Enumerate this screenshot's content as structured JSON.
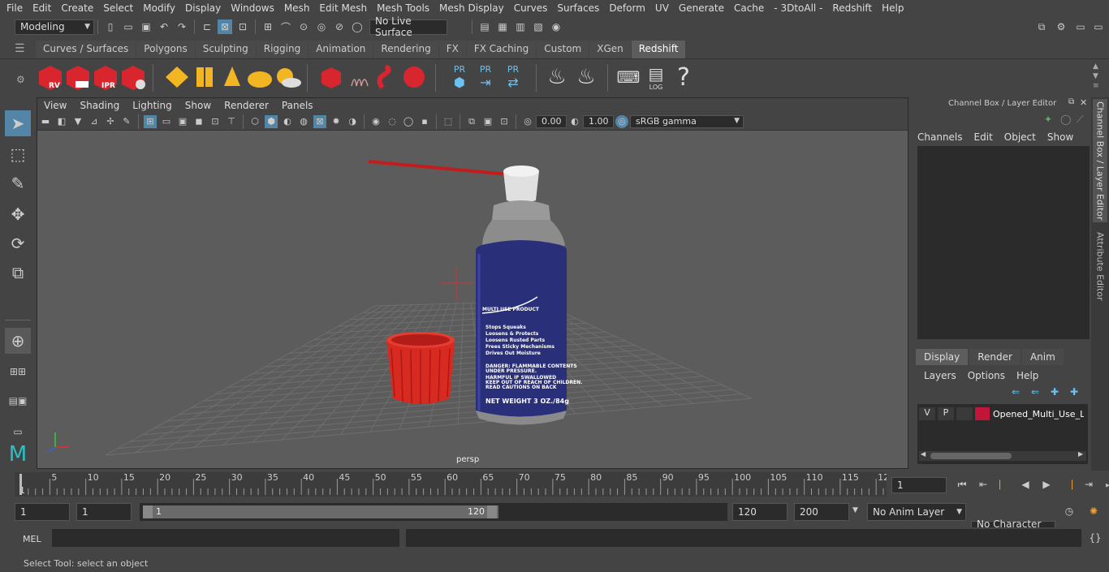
{
  "menu": [
    "File",
    "Edit",
    "Create",
    "Select",
    "Modify",
    "Display",
    "Windows",
    "Mesh",
    "Edit Mesh",
    "Mesh Tools",
    "Mesh Display",
    "Curves",
    "Surfaces",
    "Deform",
    "UV",
    "Generate",
    "Cache",
    "- 3DtoAll -",
    "Redshift",
    "Help"
  ],
  "status": {
    "workspace": "Modeling",
    "live_surface": "No Live Surface"
  },
  "shelf_tabs": [
    "Curves / Surfaces",
    "Polygons",
    "Sculpting",
    "Rigging",
    "Animation",
    "Rendering",
    "FX",
    "FX Caching",
    "Custom",
    "XGen",
    "Redshift"
  ],
  "active_shelf_tab": "Redshift",
  "shelf_labels": {
    "rv": "RV",
    "ipr": "IPR",
    "pr1": "PR",
    "pr2": "PR",
    "pr3": "PR",
    "log": "LOG",
    "help": "?"
  },
  "viewport": {
    "menu": [
      "View",
      "Shading",
      "Lighting",
      "Show",
      "Renderer",
      "Panels"
    ],
    "exposure": "0.00",
    "gamma": "1.00",
    "color_space": "sRGB gamma",
    "camera_label": "persp",
    "can_text": [
      "MULTI USE PRODUCT",
      "Stops Squeaks",
      "Loosens & Protects",
      "Loosens Rusted Parts",
      "Frees Sticky Mechanisms",
      "Drives Out Moisture",
      "DANGER: FLAMMABLE CONTENTS",
      "UNDER PRESSURE.",
      "HARMFUL IF SWALLOWED",
      "KEEP OUT OF REACH OF CHILDREN.",
      "READ CAUTIONS ON BACK",
      "NET WEIGHT 3 OZ./84g"
    ]
  },
  "channel_box": {
    "title": "Channel Box / Layer Editor",
    "menu": [
      "Channels",
      "Edit",
      "Object",
      "Show"
    ],
    "tabs": [
      "Display",
      "Render",
      "Anim"
    ],
    "active_tab": "Display",
    "layer_menu": [
      "Layers",
      "Options",
      "Help"
    ],
    "layer": {
      "v": "V",
      "p": "P",
      "name": "Opened_Multi_Use_Lu",
      "color": "#c0163a"
    }
  },
  "side_tabs": [
    "Channel Box / Layer Editor",
    "Attribute Editor"
  ],
  "timeline": {
    "ticks": [
      "5",
      "10",
      "15",
      "20",
      "25",
      "30",
      "35",
      "40",
      "45",
      "50",
      "55",
      "60",
      "65",
      "70",
      "75",
      "80",
      "85",
      "90",
      "95",
      "100",
      "105",
      "110",
      "115",
      "12"
    ],
    "start_marker": "1",
    "current_frame": "1"
  },
  "range": {
    "start": "1",
    "start2": "1",
    "slider_start": "1",
    "slider_end": "120",
    "end": "120",
    "end2": "200",
    "anim_layer": "No Anim Layer",
    "char_set": "No Character Set"
  },
  "cmd": {
    "label": "MEL"
  },
  "help_line": "Select Tool: select an object",
  "colors": {
    "accent": "#5285a6",
    "redshift_red": "#d9262e",
    "can_blue": "#2a2f7a"
  }
}
